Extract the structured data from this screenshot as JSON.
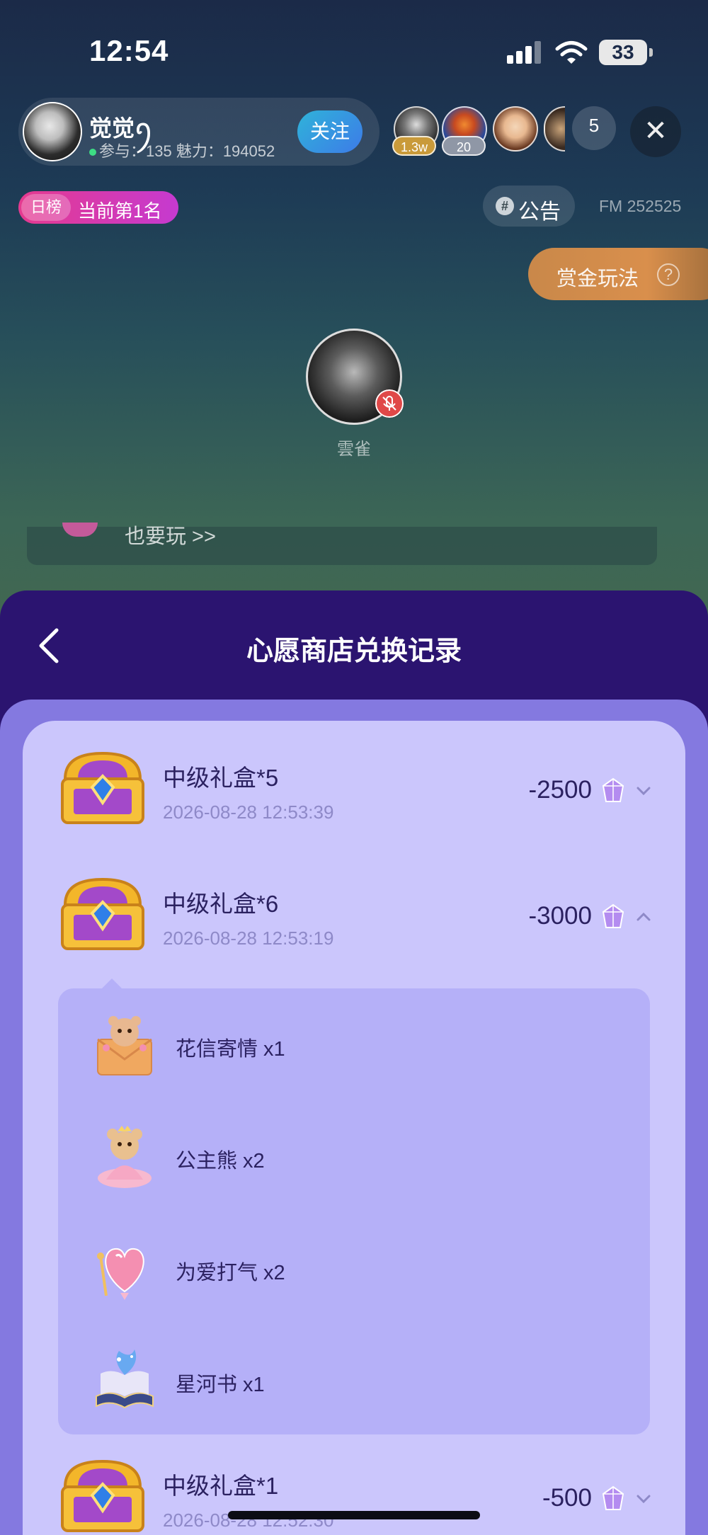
{
  "status_bar": {
    "time": "12:54",
    "battery": "33"
  },
  "host": {
    "name": "觉觉ꪆ",
    "stats": "参与：135 魅力：194052",
    "follow_label": "关注"
  },
  "viewers": {
    "badge_1": "1.3w",
    "badge_2": "20",
    "count": "5"
  },
  "rank": {
    "tag": "日榜",
    "text": "当前第1名"
  },
  "notice": {
    "label": "公告",
    "fm": "FM 252525"
  },
  "bounty": {
    "label": "赏金玩法",
    "help": "?"
  },
  "mic": {
    "name": "雲雀"
  },
  "partial_banner": {
    "text": "也要玩 >>"
  },
  "sheet": {
    "title": "心愿商店兑换记录",
    "records": [
      {
        "title": "中级礼盒*5",
        "time": "2026-08-28 12:53:39",
        "amount": "-2500",
        "expanded": false
      },
      {
        "title": "中级礼盒*6",
        "time": "2026-08-28 12:53:19",
        "amount": "-3000",
        "expanded": true
      },
      {
        "title": "中级礼盒*1",
        "time": "2026-08-28 12:52:30",
        "amount": "-500",
        "expanded": false
      }
    ],
    "details": [
      {
        "label": "花信寄情 x1",
        "icon": "envelope-bear-gift-icon"
      },
      {
        "label": "公主熊 x2",
        "icon": "princess-bear-gift-icon"
      },
      {
        "label": "为爱打气 x2",
        "icon": "heart-balloon-gift-icon"
      },
      {
        "label": "星河书 x1",
        "icon": "galaxy-book-gift-icon"
      }
    ]
  },
  "colors": {
    "sheet_header": "#2b1470",
    "sheet_body": "#8479e0",
    "list_card": "#cbc6fc",
    "detail_box": "#b5b0f8",
    "text_dark": "#2b2160",
    "text_muted": "#8e89c8"
  }
}
